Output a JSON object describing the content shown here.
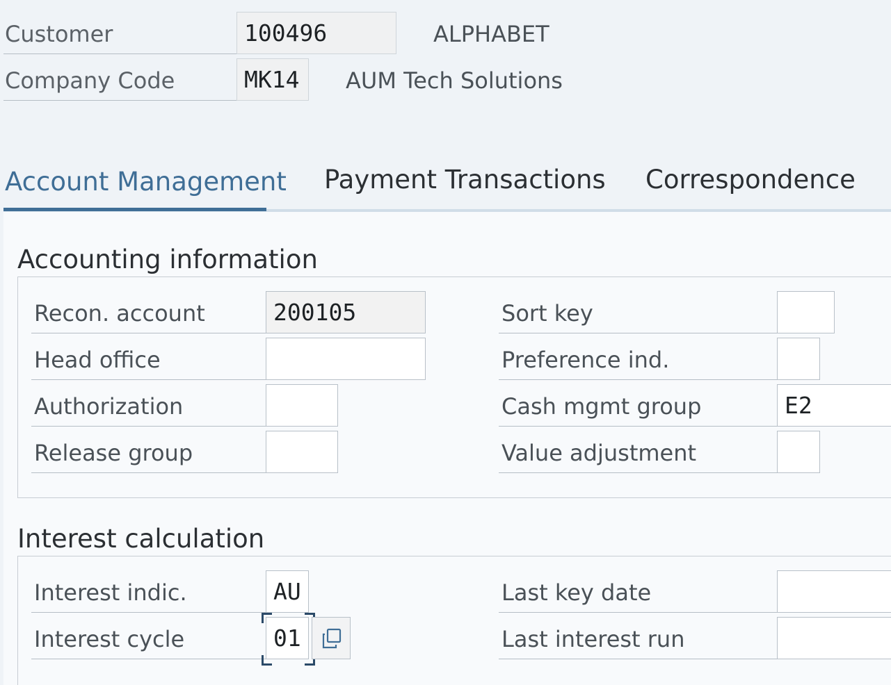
{
  "header": {
    "customer": {
      "label": "Customer",
      "value": "100496",
      "name": "ALPHABET"
    },
    "company_code": {
      "label": "Company Code",
      "value": "MK14",
      "name": "AUM Tech Solutions"
    }
  },
  "tabs": [
    {
      "label": "Account Management",
      "active": true
    },
    {
      "label": "Payment Transactions",
      "active": false
    },
    {
      "label": "Correspondence",
      "active": false
    }
  ],
  "accounting_information": {
    "title": "Accounting information",
    "recon_account": {
      "label": "Recon. account",
      "value": "200105"
    },
    "head_office": {
      "label": "Head office",
      "value": ""
    },
    "authorization": {
      "label": "Authorization",
      "value": ""
    },
    "release_group": {
      "label": "Release group",
      "value": ""
    },
    "sort_key": {
      "label": "Sort key",
      "value": ""
    },
    "preference_ind": {
      "label": "Preference ind.",
      "value": ""
    },
    "cash_mgmt_group": {
      "label": "Cash mgmt group",
      "value": "E2"
    },
    "value_adjustment": {
      "label": "Value adjustment",
      "value": ""
    }
  },
  "interest_calculation": {
    "title": "Interest calculation",
    "interest_indic": {
      "label": "Interest indic.",
      "value": "AU"
    },
    "interest_cycle": {
      "label": "Interest cycle",
      "value": "01"
    },
    "last_key_date": {
      "label": "Last key date",
      "value": ""
    },
    "last_interest_run": {
      "label": "Last interest run",
      "value": ""
    }
  },
  "icons": {
    "value_help": "copy-icon"
  },
  "colors": {
    "accent": "#3f6e96",
    "background": "#eff3f7",
    "panel": "#f8fafc"
  }
}
